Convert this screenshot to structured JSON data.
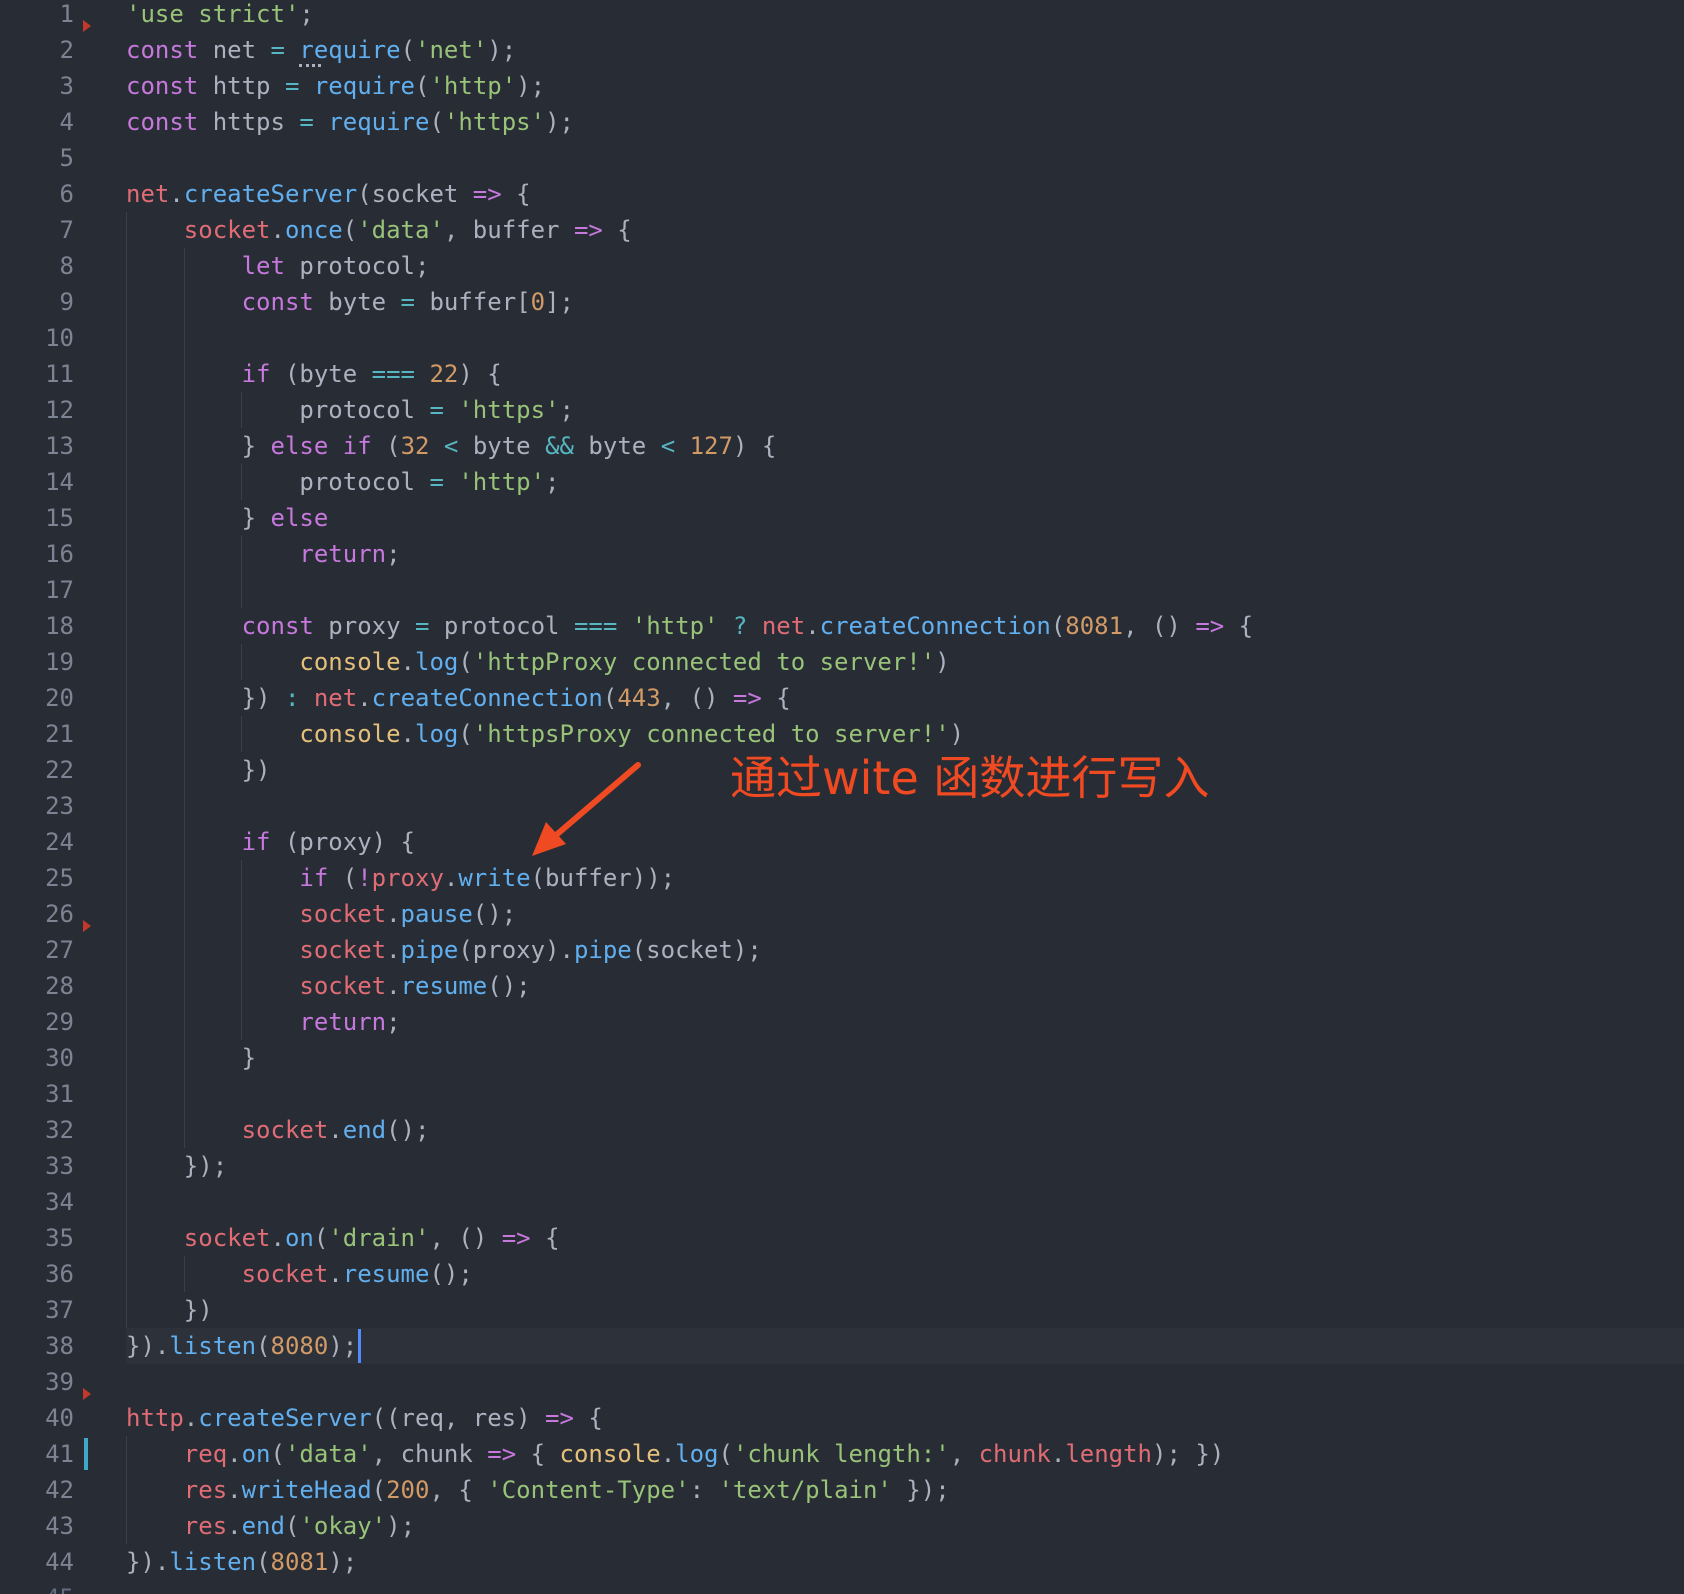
{
  "editor": {
    "lines": [
      [
        [
          "s",
          "'use strict'"
        ],
        [
          "p",
          ";"
        ]
      ],
      [
        [
          "k",
          "const"
        ],
        [
          "p",
          " net "
        ],
        [
          "o",
          "="
        ],
        [
          "p",
          " "
        ],
        [
          "f",
          "require"
        ],
        [
          "p",
          "("
        ],
        [
          "s",
          "'net'"
        ],
        [
          "p",
          ");"
        ]
      ],
      [
        [
          "k",
          "const"
        ],
        [
          "p",
          " http "
        ],
        [
          "o",
          "="
        ],
        [
          "p",
          " "
        ],
        [
          "f",
          "require"
        ],
        [
          "p",
          "("
        ],
        [
          "s",
          "'http'"
        ],
        [
          "p",
          ");"
        ]
      ],
      [
        [
          "k",
          "const"
        ],
        [
          "p",
          " https "
        ],
        [
          "o",
          "="
        ],
        [
          "p",
          " "
        ],
        [
          "f",
          "require"
        ],
        [
          "p",
          "("
        ],
        [
          "s",
          "'https'"
        ],
        [
          "p",
          ");"
        ]
      ],
      [],
      [
        [
          "v",
          "net"
        ],
        [
          "p",
          "."
        ],
        [
          "f",
          "createServer"
        ],
        [
          "p",
          "(socket "
        ],
        [
          "k",
          "=>"
        ],
        [
          "p",
          " {"
        ]
      ],
      [
        [
          "p",
          "    "
        ],
        [
          "v",
          "socket"
        ],
        [
          "p",
          "."
        ],
        [
          "f",
          "once"
        ],
        [
          "p",
          "("
        ],
        [
          "s",
          "'data'"
        ],
        [
          "p",
          ", buffer "
        ],
        [
          "k",
          "=>"
        ],
        [
          "p",
          " {"
        ]
      ],
      [
        [
          "p",
          "        "
        ],
        [
          "k",
          "let"
        ],
        [
          "p",
          " protocol;"
        ]
      ],
      [
        [
          "p",
          "        "
        ],
        [
          "k",
          "const"
        ],
        [
          "p",
          " byte "
        ],
        [
          "o",
          "="
        ],
        [
          "p",
          " buffer["
        ],
        [
          "n",
          "0"
        ],
        [
          "p",
          "];"
        ]
      ],
      [],
      [
        [
          "p",
          "        "
        ],
        [
          "k",
          "if"
        ],
        [
          "p",
          " (byte "
        ],
        [
          "o",
          "==="
        ],
        [
          "p",
          " "
        ],
        [
          "n",
          "22"
        ],
        [
          "p",
          ") {"
        ]
      ],
      [
        [
          "p",
          "            protocol "
        ],
        [
          "o",
          "="
        ],
        [
          "p",
          " "
        ],
        [
          "s",
          "'https'"
        ],
        [
          "p",
          ";"
        ]
      ],
      [
        [
          "p",
          "        } "
        ],
        [
          "k",
          "else"
        ],
        [
          "p",
          " "
        ],
        [
          "k",
          "if"
        ],
        [
          "p",
          " ("
        ],
        [
          "n",
          "32"
        ],
        [
          "p",
          " "
        ],
        [
          "o",
          "<"
        ],
        [
          "p",
          " byte "
        ],
        [
          "o",
          "&&"
        ],
        [
          "p",
          " byte "
        ],
        [
          "o",
          "<"
        ],
        [
          "p",
          " "
        ],
        [
          "n",
          "127"
        ],
        [
          "p",
          ") {"
        ]
      ],
      [
        [
          "p",
          "            protocol "
        ],
        [
          "o",
          "="
        ],
        [
          "p",
          " "
        ],
        [
          "s",
          "'http'"
        ],
        [
          "p",
          ";"
        ]
      ],
      [
        [
          "p",
          "        } "
        ],
        [
          "k",
          "else"
        ]
      ],
      [
        [
          "p",
          "            "
        ],
        [
          "k",
          "return"
        ],
        [
          "p",
          ";"
        ]
      ],
      [],
      [
        [
          "p",
          "        "
        ],
        [
          "k",
          "const"
        ],
        [
          "p",
          " proxy "
        ],
        [
          "o",
          "="
        ],
        [
          "p",
          " protocol "
        ],
        [
          "o",
          "==="
        ],
        [
          "p",
          " "
        ],
        [
          "s",
          "'http'"
        ],
        [
          "p",
          " "
        ],
        [
          "o",
          "?"
        ],
        [
          "p",
          " "
        ],
        [
          "v",
          "net"
        ],
        [
          "p",
          "."
        ],
        [
          "f",
          "createConnection"
        ],
        [
          "p",
          "("
        ],
        [
          "n",
          "8081"
        ],
        [
          "p",
          ", () "
        ],
        [
          "k",
          "=>"
        ],
        [
          "p",
          " {"
        ]
      ],
      [
        [
          "p",
          "            "
        ],
        [
          "t",
          "console"
        ],
        [
          "p",
          "."
        ],
        [
          "f",
          "log"
        ],
        [
          "p",
          "("
        ],
        [
          "s",
          "'httpProxy connected to server!'"
        ],
        [
          "p",
          ")"
        ]
      ],
      [
        [
          "p",
          "        }) "
        ],
        [
          "o",
          ":"
        ],
        [
          "p",
          " "
        ],
        [
          "v",
          "net"
        ],
        [
          "p",
          "."
        ],
        [
          "f",
          "createConnection"
        ],
        [
          "p",
          "("
        ],
        [
          "n",
          "443"
        ],
        [
          "p",
          ", () "
        ],
        [
          "k",
          "=>"
        ],
        [
          "p",
          " {"
        ]
      ],
      [
        [
          "p",
          "            "
        ],
        [
          "t",
          "console"
        ],
        [
          "p",
          "."
        ],
        [
          "f",
          "log"
        ],
        [
          "p",
          "("
        ],
        [
          "s",
          "'httpsProxy connected to server!'"
        ],
        [
          "p",
          ")"
        ]
      ],
      [
        [
          "p",
          "        })"
        ]
      ],
      [],
      [
        [
          "p",
          "        "
        ],
        [
          "k",
          "if"
        ],
        [
          "p",
          " (proxy) {"
        ]
      ],
      [
        [
          "p",
          "            "
        ],
        [
          "k",
          "if"
        ],
        [
          "p",
          " ("
        ],
        [
          "k",
          "!"
        ],
        [
          "v",
          "proxy"
        ],
        [
          "p",
          "."
        ],
        [
          "f",
          "write"
        ],
        [
          "p",
          "(buffer));"
        ]
      ],
      [
        [
          "p",
          "            "
        ],
        [
          "v",
          "socket"
        ],
        [
          "p",
          "."
        ],
        [
          "f",
          "pause"
        ],
        [
          "p",
          "();"
        ]
      ],
      [
        [
          "p",
          "            "
        ],
        [
          "v",
          "socket"
        ],
        [
          "p",
          "."
        ],
        [
          "f",
          "pipe"
        ],
        [
          "p",
          "(proxy)."
        ],
        [
          "f",
          "pipe"
        ],
        [
          "p",
          "(socket);"
        ]
      ],
      [
        [
          "p",
          "            "
        ],
        [
          "v",
          "socket"
        ],
        [
          "p",
          "."
        ],
        [
          "f",
          "resume"
        ],
        [
          "p",
          "();"
        ]
      ],
      [
        [
          "p",
          "            "
        ],
        [
          "k",
          "return"
        ],
        [
          "p",
          ";"
        ]
      ],
      [
        [
          "p",
          "        }"
        ]
      ],
      [],
      [
        [
          "p",
          "        "
        ],
        [
          "v",
          "socket"
        ],
        [
          "p",
          "."
        ],
        [
          "f",
          "end"
        ],
        [
          "p",
          "();"
        ]
      ],
      [
        [
          "p",
          "    });"
        ]
      ],
      [],
      [
        [
          "p",
          "    "
        ],
        [
          "v",
          "socket"
        ],
        [
          "p",
          "."
        ],
        [
          "f",
          "on"
        ],
        [
          "p",
          "("
        ],
        [
          "s",
          "'drain'"
        ],
        [
          "p",
          ", () "
        ],
        [
          "k",
          "=>"
        ],
        [
          "p",
          " {"
        ]
      ],
      [
        [
          "p",
          "        "
        ],
        [
          "v",
          "socket"
        ],
        [
          "p",
          "."
        ],
        [
          "f",
          "resume"
        ],
        [
          "p",
          "();"
        ]
      ],
      [
        [
          "p",
          "    })"
        ]
      ],
      [
        [
          "p",
          "})."
        ],
        [
          "f",
          "listen"
        ],
        [
          "p",
          "("
        ],
        [
          "n",
          "8080"
        ],
        [
          "p",
          ");"
        ]
      ],
      [],
      [
        [
          "v",
          "http"
        ],
        [
          "p",
          "."
        ],
        [
          "f",
          "createServer"
        ],
        [
          "p",
          "((req, res) "
        ],
        [
          "k",
          "=>"
        ],
        [
          "p",
          " {"
        ]
      ],
      [
        [
          "p",
          "    "
        ],
        [
          "v",
          "req"
        ],
        [
          "p",
          "."
        ],
        [
          "f",
          "on"
        ],
        [
          "p",
          "("
        ],
        [
          "s",
          "'data'"
        ],
        [
          "p",
          ", chunk "
        ],
        [
          "k",
          "=>"
        ],
        [
          "p",
          " { "
        ],
        [
          "t",
          "console"
        ],
        [
          "p",
          "."
        ],
        [
          "f",
          "log"
        ],
        [
          "p",
          "("
        ],
        [
          "s",
          "'chunk length:'"
        ],
        [
          "p",
          ", "
        ],
        [
          "v",
          "chunk"
        ],
        [
          "p",
          "."
        ],
        [
          "v",
          "length"
        ],
        [
          "p",
          "); })"
        ]
      ],
      [
        [
          "p",
          "    "
        ],
        [
          "v",
          "res"
        ],
        [
          "p",
          "."
        ],
        [
          "f",
          "writeHead"
        ],
        [
          "p",
          "("
        ],
        [
          "n",
          "200"
        ],
        [
          "p",
          ", { "
        ],
        [
          "s",
          "'Content-Type'"
        ],
        [
          "p",
          ": "
        ],
        [
          "s",
          "'text/plain'"
        ],
        [
          "p",
          " });"
        ]
      ],
      [
        [
          "p",
          "    "
        ],
        [
          "v",
          "res"
        ],
        [
          "p",
          "."
        ],
        [
          "f",
          "end"
        ],
        [
          "p",
          "("
        ],
        [
          "s",
          "'okay'"
        ],
        [
          "p",
          ");"
        ]
      ],
      [
        [
          "p",
          "})."
        ],
        [
          "f",
          "listen"
        ],
        [
          "p",
          "("
        ],
        [
          "n",
          "8081"
        ],
        [
          "p",
          ");"
        ]
      ]
    ],
    "partial_line_number": "45",
    "active_line": 38,
    "colors": {
      "background": "#282c34",
      "keyword": "#c678dd",
      "string": "#98c379",
      "function": "#61afef",
      "variable": "#e06c75",
      "number": "#d19a66",
      "operator": "#56b6c2",
      "builtin": "#e5c07b",
      "annotation": "#f04a23"
    }
  },
  "annotation": {
    "text": "通过wite 函数进行写入"
  }
}
